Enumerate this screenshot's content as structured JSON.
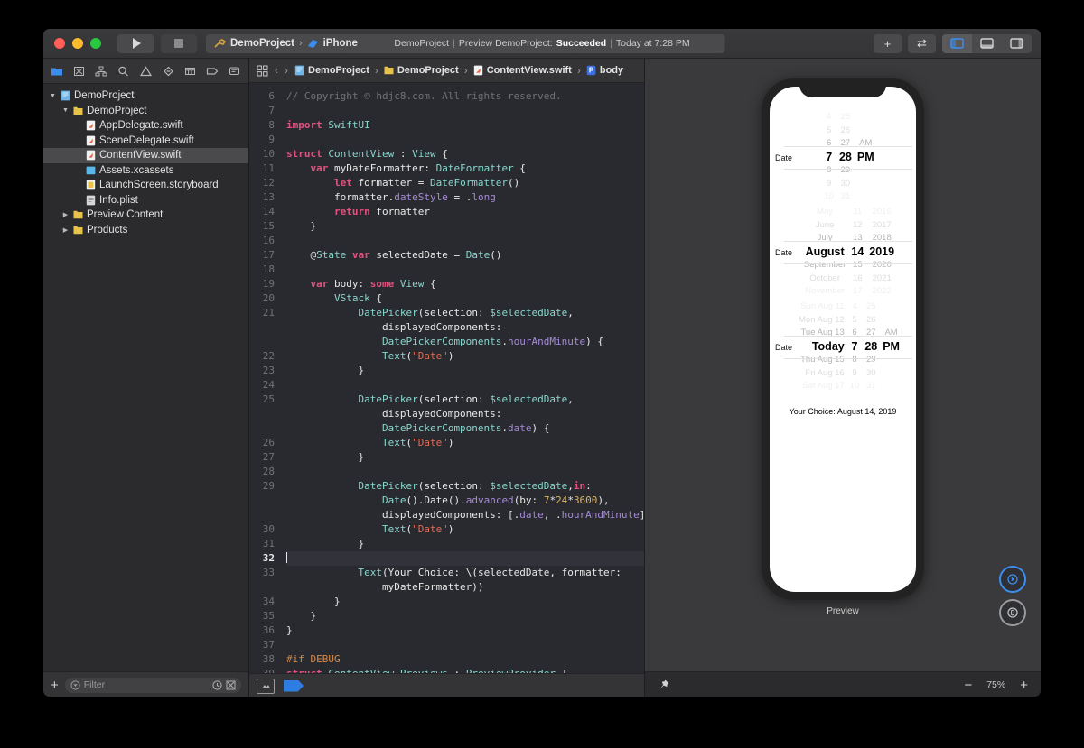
{
  "window": {
    "traffic_lights": [
      "close",
      "minimize",
      "maximize"
    ],
    "run_button": "run-icon",
    "stop_button": "stop-icon",
    "scheme": {
      "project": "DemoProject",
      "separator": "›",
      "destination": "iPhone Xʀ"
    },
    "status": {
      "project": "DemoProject",
      "sep1": "|",
      "activity": "Preview DemoProject:",
      "result": "Succeeded",
      "sep2": "|",
      "time": "Today at 7:28 PM"
    },
    "toolbar_right": {
      "add_label": "+",
      "swap_label": "⇄",
      "panes": [
        "navigator-pane",
        "debug-pane",
        "inspector-pane"
      ],
      "active_pane": "navigator-pane"
    }
  },
  "navigator": {
    "icons": [
      "folder-icon",
      "source-control-icon",
      "symbol-icon",
      "search-icon",
      "warning-icon",
      "test-icon",
      "debug-icon",
      "breakpoint-icon",
      "report-icon"
    ],
    "active_icon": "folder-icon",
    "tree": [
      {
        "label": "DemoProject",
        "depth": 0,
        "icon": "project-icon",
        "arrow": "▼",
        "selected": false
      },
      {
        "label": "DemoProject",
        "depth": 1,
        "icon": "folder-icon",
        "arrow": "▼",
        "selected": false
      },
      {
        "label": "AppDelegate.swift",
        "depth": 2,
        "icon": "swift-icon",
        "arrow": "",
        "selected": false
      },
      {
        "label": "SceneDelegate.swift",
        "depth": 2,
        "icon": "swift-icon",
        "arrow": "",
        "selected": false
      },
      {
        "label": "ContentView.swift",
        "depth": 2,
        "icon": "swift-icon",
        "arrow": "",
        "selected": true
      },
      {
        "label": "Assets.xcassets",
        "depth": 2,
        "icon": "assets-icon",
        "arrow": "",
        "selected": false
      },
      {
        "label": "LaunchScreen.storyboard",
        "depth": 2,
        "icon": "storyboard-icon",
        "arrow": "",
        "selected": false
      },
      {
        "label": "Info.plist",
        "depth": 2,
        "icon": "plist-icon",
        "arrow": "",
        "selected": false
      },
      {
        "label": "Preview Content",
        "depth": 1,
        "icon": "folder-icon",
        "arrow": "▶",
        "selected": false
      },
      {
        "label": "Products",
        "depth": 1,
        "icon": "folder-icon",
        "arrow": "▶",
        "selected": false
      }
    ],
    "footer": {
      "add_label": "+",
      "filter_placeholder": "Filter",
      "recent_icon": "clock-icon",
      "unsaved_icon": "unsaved-icon"
    }
  },
  "editor": {
    "jumpbar": {
      "grid_icon": "related-items-icon",
      "back_label": "‹",
      "forward_label": "›",
      "crumbs": [
        {
          "label": "DemoProject",
          "icon": "project-icon"
        },
        {
          "label": "DemoProject",
          "icon": "folder-icon"
        },
        {
          "label": "ContentView.swift",
          "icon": "swift-icon"
        },
        {
          "label": "body",
          "icon": "property-icon"
        }
      ],
      "separator": "›"
    },
    "first_line_number": 6,
    "current_line": 32,
    "lines": [
      {
        "n": 6,
        "t": "// Copyright © hdjc8.com. All rights reserved.",
        "k": "cm"
      },
      {
        "n": 7,
        "t": ""
      },
      {
        "n": 8,
        "t": "import SwiftUI"
      },
      {
        "n": 9,
        "t": ""
      },
      {
        "n": 10,
        "t": "struct ContentView : View {"
      },
      {
        "n": 11,
        "t": "    var myDateFormatter: DateFormatter {"
      },
      {
        "n": 12,
        "t": "        let formatter = DateFormatter()"
      },
      {
        "n": 13,
        "t": "        formatter.dateStyle = .long"
      },
      {
        "n": 14,
        "t": "        return formatter"
      },
      {
        "n": 15,
        "t": "    }"
      },
      {
        "n": 16,
        "t": ""
      },
      {
        "n": 17,
        "t": "    @State var selectedDate = Date()"
      },
      {
        "n": 18,
        "t": ""
      },
      {
        "n": 19,
        "t": "    var body: some View {"
      },
      {
        "n": 20,
        "t": "        VStack {"
      },
      {
        "n": 21,
        "t": "            DatePicker(selection: $selectedDate,"
      },
      {
        "n": "",
        "t": "                displayedComponents:"
      },
      {
        "n": "",
        "t": "                DatePickerComponents.hourAndMinute) {"
      },
      {
        "n": 22,
        "t": "                Text(\"Date\")"
      },
      {
        "n": 23,
        "t": "            }"
      },
      {
        "n": 24,
        "t": ""
      },
      {
        "n": 25,
        "t": "            DatePicker(selection: $selectedDate,"
      },
      {
        "n": "",
        "t": "                displayedComponents:"
      },
      {
        "n": "",
        "t": "                DatePickerComponents.date) {"
      },
      {
        "n": 26,
        "t": "                Text(\"Date\")"
      },
      {
        "n": 27,
        "t": "            }"
      },
      {
        "n": 28,
        "t": ""
      },
      {
        "n": 29,
        "t": "            DatePicker(selection: $selectedDate,in:"
      },
      {
        "n": "",
        "t": "                Date()...Date().advanced(by: 7*24*3600),"
      },
      {
        "n": "",
        "t": "                displayedComponents: [.date, .hourAndMinute]) {"
      },
      {
        "n": 30,
        "t": "                Text(\"Date\")"
      },
      {
        "n": 31,
        "t": "            }"
      },
      {
        "n": 32,
        "t": ""
      },
      {
        "n": 33,
        "t": "            Text(\"Your Choice: \\(selectedDate, formatter:"
      },
      {
        "n": "",
        "t": "                myDateFormatter)\")"
      },
      {
        "n": 34,
        "t": "        }"
      },
      {
        "n": 35,
        "t": "    }"
      },
      {
        "n": 36,
        "t": "}"
      },
      {
        "n": 37,
        "t": ""
      },
      {
        "n": 38,
        "t": "#if DEBUG"
      },
      {
        "n": 39,
        "t": "struct ContentView_Previews : PreviewProvider {"
      }
    ],
    "footer": {
      "split_icon": "split-editor-icon",
      "bookmark_icon": "bookmark-icon"
    }
  },
  "preview": {
    "device": "iPhone Xʀ",
    "label": "Preview",
    "pickers": [
      {
        "label": "Date",
        "wheels": [
          {
            "name": "hour",
            "items": [
              "4",
              "5",
              "6",
              "7",
              "8",
              "9",
              "10"
            ],
            "selected_index": 3
          },
          {
            "name": "minute",
            "items": [
              "25",
              "26",
              "27",
              "28",
              "29",
              "30",
              "31"
            ],
            "selected_index": 3
          },
          {
            "name": "meridiem",
            "items": [
              "",
              "",
              "AM",
              "PM",
              "",
              "",
              ""
            ],
            "selected_index": 3
          }
        ]
      },
      {
        "label": "Date",
        "wheels": [
          {
            "name": "month",
            "items": [
              "May",
              "June",
              "July",
              "August",
              "September",
              "October",
              "November"
            ],
            "selected_index": 3
          },
          {
            "name": "day",
            "items": [
              "11",
              "12",
              "13",
              "14",
              "15",
              "16",
              "17"
            ],
            "selected_index": 3
          },
          {
            "name": "year",
            "items": [
              "2016",
              "2017",
              "2018",
              "2019",
              "2020",
              "2021",
              "2022"
            ],
            "selected_index": 3
          }
        ]
      },
      {
        "label": "Date",
        "wheels": [
          {
            "name": "day",
            "items": [
              "Sun Aug 11",
              "Mon Aug 12",
              "Tue Aug 13",
              "Today",
              "Thu Aug 15",
              "Fri Aug 16",
              "Sat Aug 17"
            ],
            "selected_index": 3
          },
          {
            "name": "hour",
            "items": [
              "4",
              "5",
              "6",
              "7",
              "8",
              "9",
              "10"
            ],
            "selected_index": 3
          },
          {
            "name": "minute",
            "items": [
              "25",
              "26",
              "27",
              "28",
              "29",
              "30",
              "31"
            ],
            "selected_index": 3
          },
          {
            "name": "meridiem",
            "items": [
              "",
              "",
              "AM",
              "PM",
              "",
              "",
              ""
            ],
            "selected_index": 3
          }
        ]
      }
    ],
    "result_text": "Your Choice: August 14, 2019",
    "controls": {
      "live_preview": "live-preview-icon",
      "inspect": "inspect-icon"
    },
    "footer": {
      "pin_icon": "pin-icon",
      "zoom_out": "−",
      "zoom_level": "75%",
      "zoom_in": "+"
    }
  },
  "colors": {
    "accent": "#3b8ef0",
    "keyword": "#e3517f",
    "type": "#8ad6cd",
    "property": "#a78bd8",
    "string": "#e06c5a",
    "number": "#d6b36a",
    "comment": "#6f7277",
    "preprocessor": "#d98a4a"
  }
}
